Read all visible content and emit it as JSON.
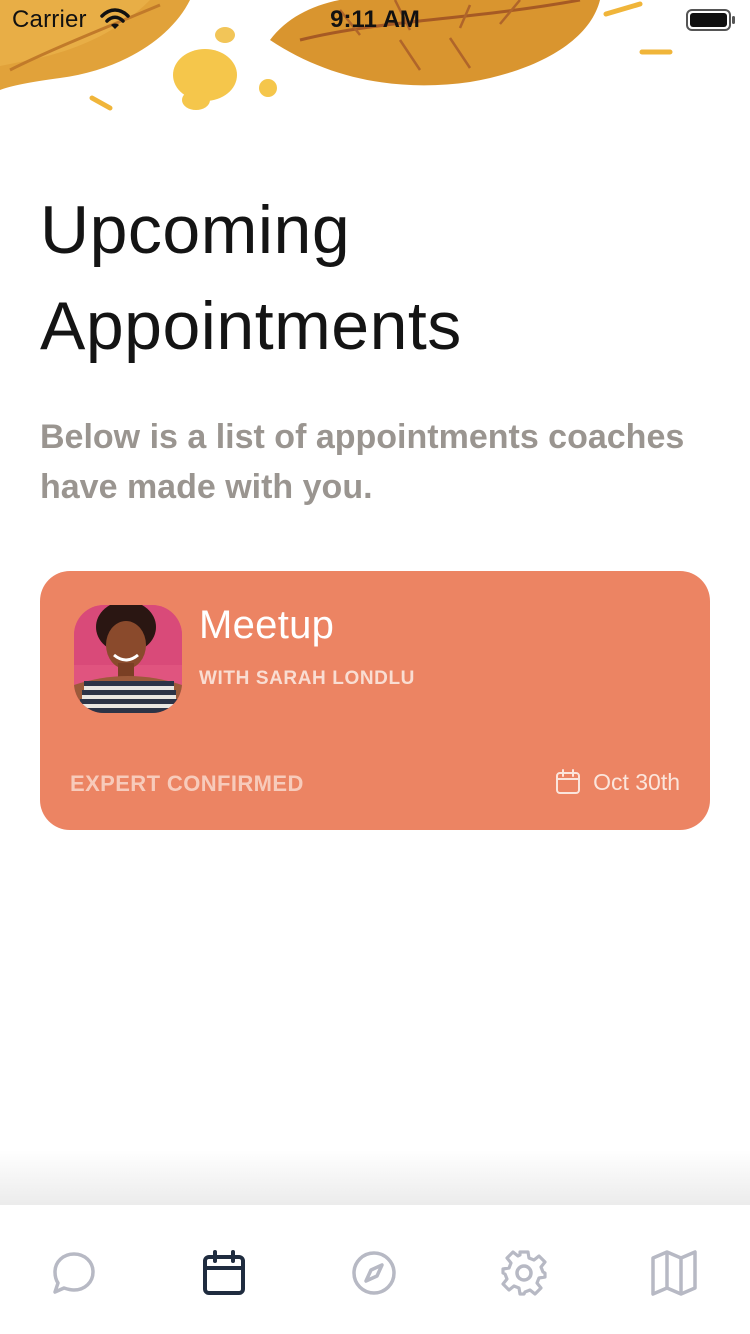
{
  "status_bar": {
    "carrier": "Carrier",
    "time": "9:11 AM"
  },
  "header": {
    "title": "Upcoming Appointments",
    "subtitle": "Below is a list of appointments coaches have made with you."
  },
  "appointments": [
    {
      "title": "Meetup",
      "with": "WITH SARAH LONDLU",
      "status": "EXPERT CONFIRMED",
      "date": "Oct 30th",
      "card_color": "#ec8463"
    }
  ],
  "tab_bar": {
    "active_index": 1,
    "active_color": "#1f2c3f",
    "inactive_color": "#b7b9c4",
    "tabs": [
      {
        "icon": "chat-bubble-icon"
      },
      {
        "icon": "calendar-icon"
      },
      {
        "icon": "compass-icon"
      },
      {
        "icon": "gear-icon"
      },
      {
        "icon": "map-icon"
      }
    ]
  }
}
